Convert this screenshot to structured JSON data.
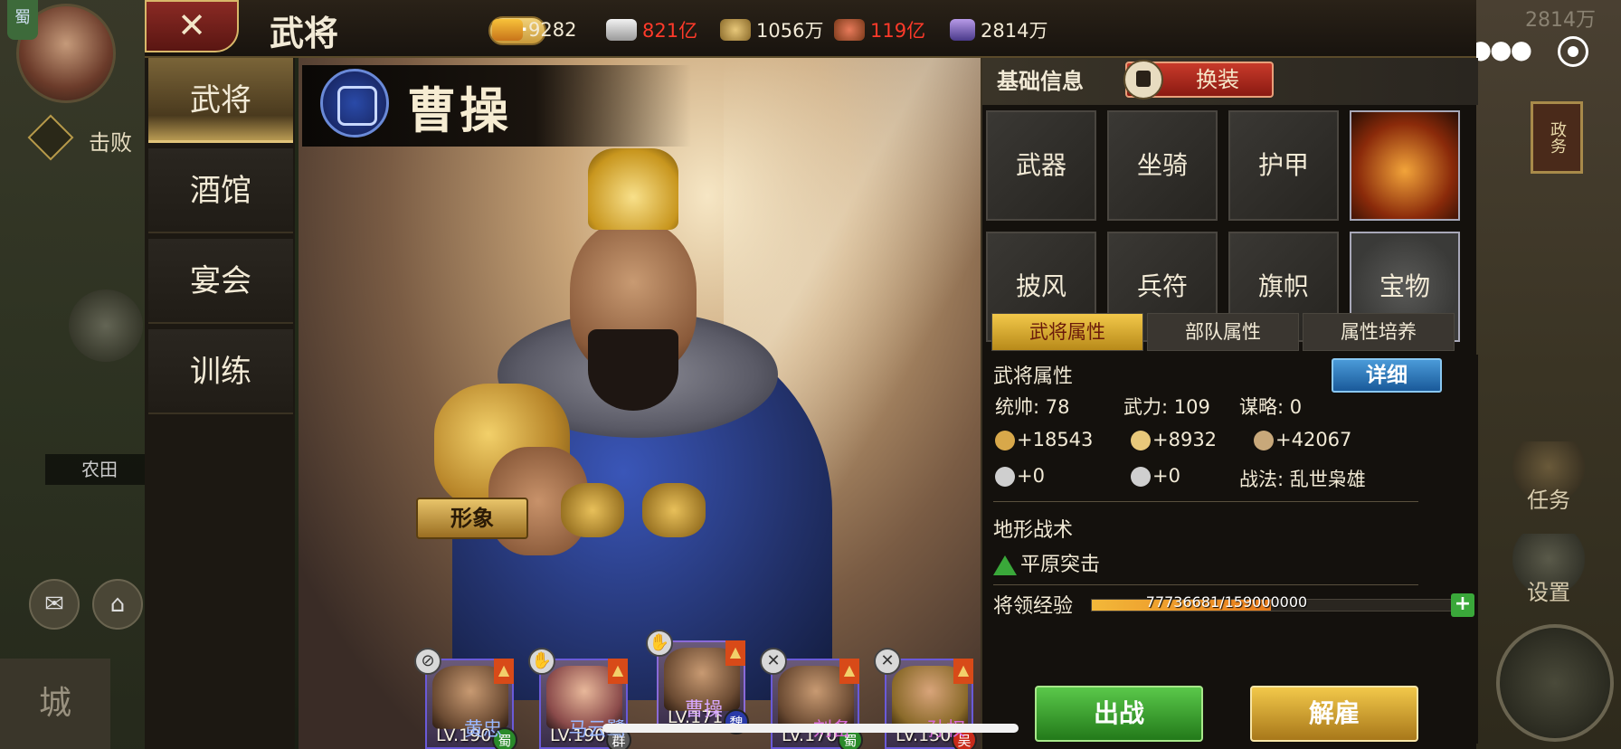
{
  "background": {
    "left_flag": "蜀",
    "left_task_label": "击败",
    "left_farm_label": "农田",
    "left_city_label": "城",
    "right_stat": "2814万",
    "right_gov_label": "政务",
    "right_task_label": "任务",
    "right_settings_label": "设置",
    "right_menu_icon": "more-dots-icon",
    "right_target_icon": "target-icon"
  },
  "topbar": {
    "close_label": "✕",
    "title": "武将",
    "add_label": "+",
    "resources": [
      {
        "icon": "gold-ingot-icon",
        "value": "9282",
        "alert": false
      },
      {
        "icon": "silver-ingot-icon",
        "value": "821亿",
        "alert": true
      },
      {
        "icon": "grain-icon",
        "value": "1056万",
        "alert": false
      },
      {
        "icon": "coin-pouch-icon",
        "value": "119亿",
        "alert": true
      },
      {
        "icon": "crystal-icon",
        "value": "2814万",
        "alert": false
      }
    ]
  },
  "nav": {
    "items": [
      {
        "label": "武将",
        "active": true
      },
      {
        "label": "酒馆",
        "active": false
      },
      {
        "label": "宴会",
        "active": false
      },
      {
        "label": "训练",
        "active": false
      }
    ]
  },
  "hero": {
    "name": "曹操",
    "image_button": "形象"
  },
  "roster": [
    {
      "name": "黄忠",
      "level": "LV.190",
      "nation": "蜀",
      "nation_color": "#2a8a2a"
    },
    {
      "name": "马云鹭",
      "level": "LV.190",
      "nation": "群",
      "nation_color": "#5a5a5a"
    },
    {
      "name": "曹操",
      "level": "LV.171",
      "nation": "魏",
      "nation_color": "#2a3aa8"
    },
    {
      "name": "刘备",
      "level": "LV.170",
      "nation": "蜀",
      "nation_color": "#2a8a2a"
    },
    {
      "name": "孙权",
      "level": "LV.150",
      "nation": "吴",
      "nation_color": "#c82a1a"
    }
  ],
  "panel": {
    "header": "基础信息",
    "swap_label": "换装",
    "slots": [
      "武器",
      "坐骑",
      "护甲",
      "",
      "披风",
      "兵符",
      "旗帜",
      "宝物"
    ],
    "tabs": [
      "武将属性",
      "部队属性",
      "属性培养"
    ],
    "stats_title": "武将属性",
    "detail_label": "详细",
    "command": "统帅: 78",
    "force": "武力: 109",
    "strategy": "谋略: 0",
    "attack": "+18543",
    "defense": "+8932",
    "troops": "+42067",
    "bonus1": "+0",
    "bonus2": "+0",
    "tactic": "战法: 乱世枭雄",
    "terrain_title": "地形战术",
    "terrain_skill": "平原突击",
    "exp_label": "将领经验",
    "exp_text": "77736681/159000000",
    "exp_fraction": 0.489,
    "battle_label": "出战",
    "dismiss_label": "解雇"
  }
}
